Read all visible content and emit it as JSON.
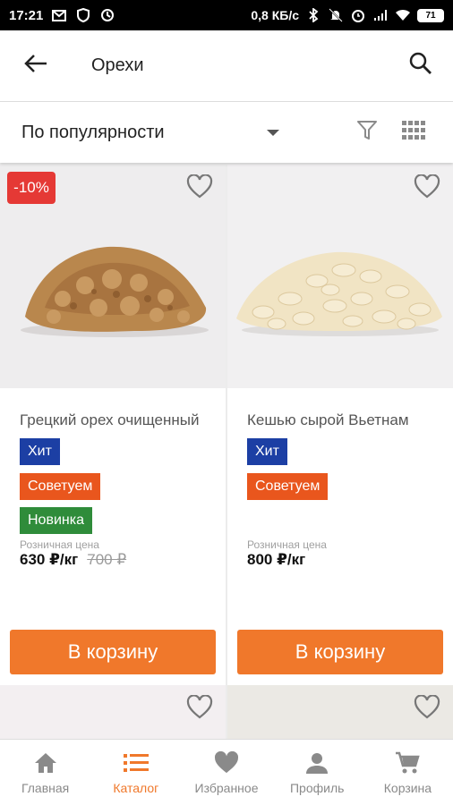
{
  "status_bar": {
    "time": "17:21",
    "network_speed": "0,8 КБ/с",
    "battery": "71"
  },
  "app_bar": {
    "title": "Орехи",
    "back_icon": "arrow-back-icon",
    "search_icon": "search-icon"
  },
  "sort_bar": {
    "selected": "По популярности",
    "filter_icon": "filter-icon",
    "view_icon": "grid-view-icon"
  },
  "products": [
    {
      "discount": "-10%",
      "name": "Грецкий орех очищенный",
      "tags": [
        "Хит",
        "Советуем",
        "Новинка"
      ],
      "price_caption": "Розничная цена",
      "price": "630 ₽/кг",
      "old_price": "700 ₽",
      "button": "В корзину"
    },
    {
      "name": "Кешью сырой Вьетнам",
      "tags": [
        "Хит",
        "Советуем"
      ],
      "price_caption": "Розничная цена",
      "price": "800 ₽/кг",
      "button": "В корзину"
    }
  ],
  "bottom_nav": [
    {
      "label": "Главная",
      "icon": "home-icon"
    },
    {
      "label": "Каталог",
      "icon": "catalog-list-icon",
      "active": true
    },
    {
      "label": "Избранное",
      "icon": "heart-icon"
    },
    {
      "label": "Профиль",
      "icon": "person-icon"
    },
    {
      "label": "Корзина",
      "icon": "cart-icon"
    }
  ],
  "colors": {
    "accent": "#f0782b",
    "tag_hit": "#1c3fa4",
    "tag_recommend": "#e9561d",
    "tag_new": "#2f8c3a",
    "discount": "#e53935"
  }
}
